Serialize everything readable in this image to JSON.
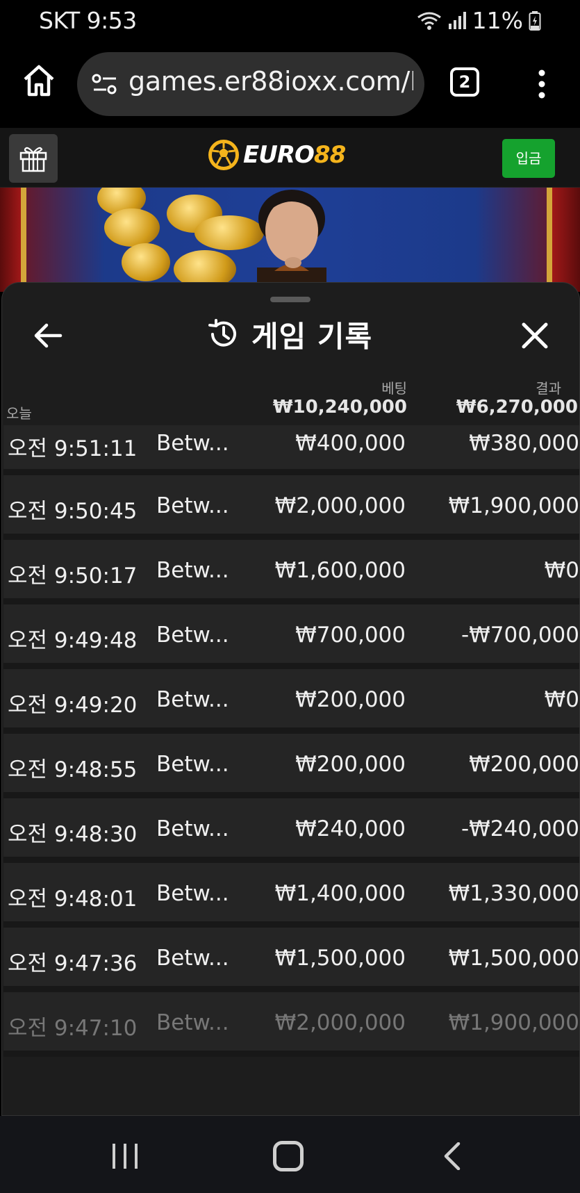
{
  "status_bar": {
    "carrier_time": "SKT 9:53",
    "battery": "11%"
  },
  "browser": {
    "url": "games.er88ioxx.com/L",
    "tab_count": "2"
  },
  "site": {
    "logo_part1": "EURO",
    "logo_part2": "88",
    "deposit_label": "입금"
  },
  "panel": {
    "title": "게임 기록",
    "today_label": "오늘",
    "bet_label": "베팅",
    "result_label": "결과",
    "total_bet": "₩10,240,000",
    "total_result": "₩6,270,000"
  },
  "rows": [
    {
      "time": "오전 9:51:11",
      "game": "Betw...",
      "bet": "₩400,000",
      "result": "₩380,000"
    },
    {
      "time": "오전 9:50:45",
      "game": "Betw...",
      "bet": "₩2,000,000",
      "result": "₩1,900,000"
    },
    {
      "time": "오전 9:50:17",
      "game": "Betw...",
      "bet": "₩1,600,000",
      "result": "₩0"
    },
    {
      "time": "오전 9:49:48",
      "game": "Betw...",
      "bet": "₩700,000",
      "result": "-₩700,000"
    },
    {
      "time": "오전 9:49:20",
      "game": "Betw...",
      "bet": "₩200,000",
      "result": "₩0"
    },
    {
      "time": "오전 9:48:55",
      "game": "Betw...",
      "bet": "₩200,000",
      "result": "₩200,000"
    },
    {
      "time": "오전 9:48:30",
      "game": "Betw...",
      "bet": "₩240,000",
      "result": "-₩240,000"
    },
    {
      "time": "오전 9:48:01",
      "game": "Betw...",
      "bet": "₩1,400,000",
      "result": "₩1,330,000"
    },
    {
      "time": "오전 9:47:36",
      "game": "Betw...",
      "bet": "₩1,500,000",
      "result": "₩1,500,000"
    },
    {
      "time": "오전 9:47:10",
      "game": "Betw...",
      "bet": "₩2,000,000",
      "result": "₩1,900,000"
    }
  ],
  "icons": {
    "home": "home-icon",
    "site_settings": "tune-icon",
    "menu": "more-vert-icon",
    "gift": "gift-icon",
    "back": "arrow-left-icon",
    "history": "history-icon",
    "close": "close-icon"
  },
  "colors": {
    "deposit_green": "#15a22e",
    "logo_gold": "#f5b41c",
    "panel_bg": "#1d1d1d",
    "row_bg": "#252525"
  }
}
